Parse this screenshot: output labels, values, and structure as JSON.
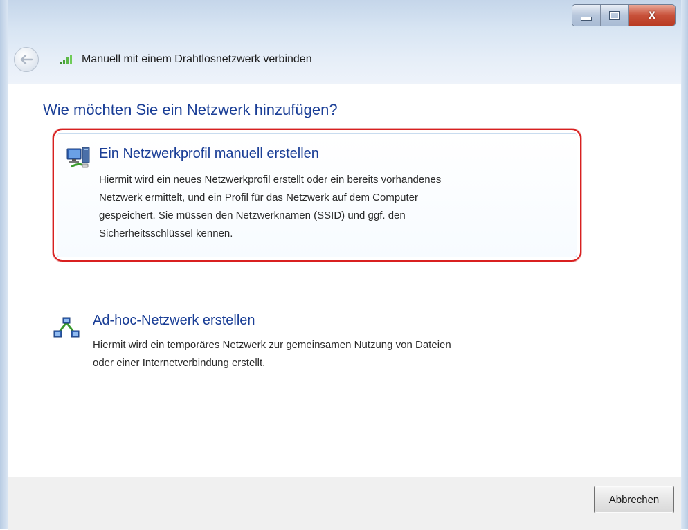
{
  "window": {
    "title": "Manuell mit einem Drahtlosnetzwerk verbinden",
    "caption_buttons": [
      "minimize",
      "maximize",
      "close"
    ],
    "close_glyph": "x"
  },
  "nav": {
    "back_icon": "back-arrow-icon",
    "network_icon": "wireless-network-icon"
  },
  "main": {
    "heading": "Wie möchten Sie ein Netzwerk hinzufügen?",
    "options": [
      {
        "icon": "network-profile-icon",
        "title": "Ein Netzwerkprofil manuell erstellen",
        "lines": [
          "Hiermit wird ein neues Netzwerkprofil erstellt oder ein bereits vorhandenes",
          "Netzwerk ermittelt, und ein Profil für das Netzwerk auf dem Computer",
          "gespeichert. Sie müssen den Netzwerknamen (SSID) und ggf. den",
          "Sicherheitsschlüssel kennen."
        ],
        "highlighted": true
      },
      {
        "icon": "adhoc-network-icon",
        "title": "Ad-hoc-Netzwerk erstellen",
        "lines": [
          "Hiermit wird ein temporäres Netzwerk zur gemeinsamen Nutzung von Dateien",
          "oder einer Internetverbindung erstellt."
        ],
        "highlighted": false
      }
    ]
  },
  "footer": {
    "cancel_label": "Abbrechen"
  },
  "colors": {
    "heading": "#1a3e96",
    "highlight_border": "#d92020",
    "close_button": "#c8513a"
  }
}
